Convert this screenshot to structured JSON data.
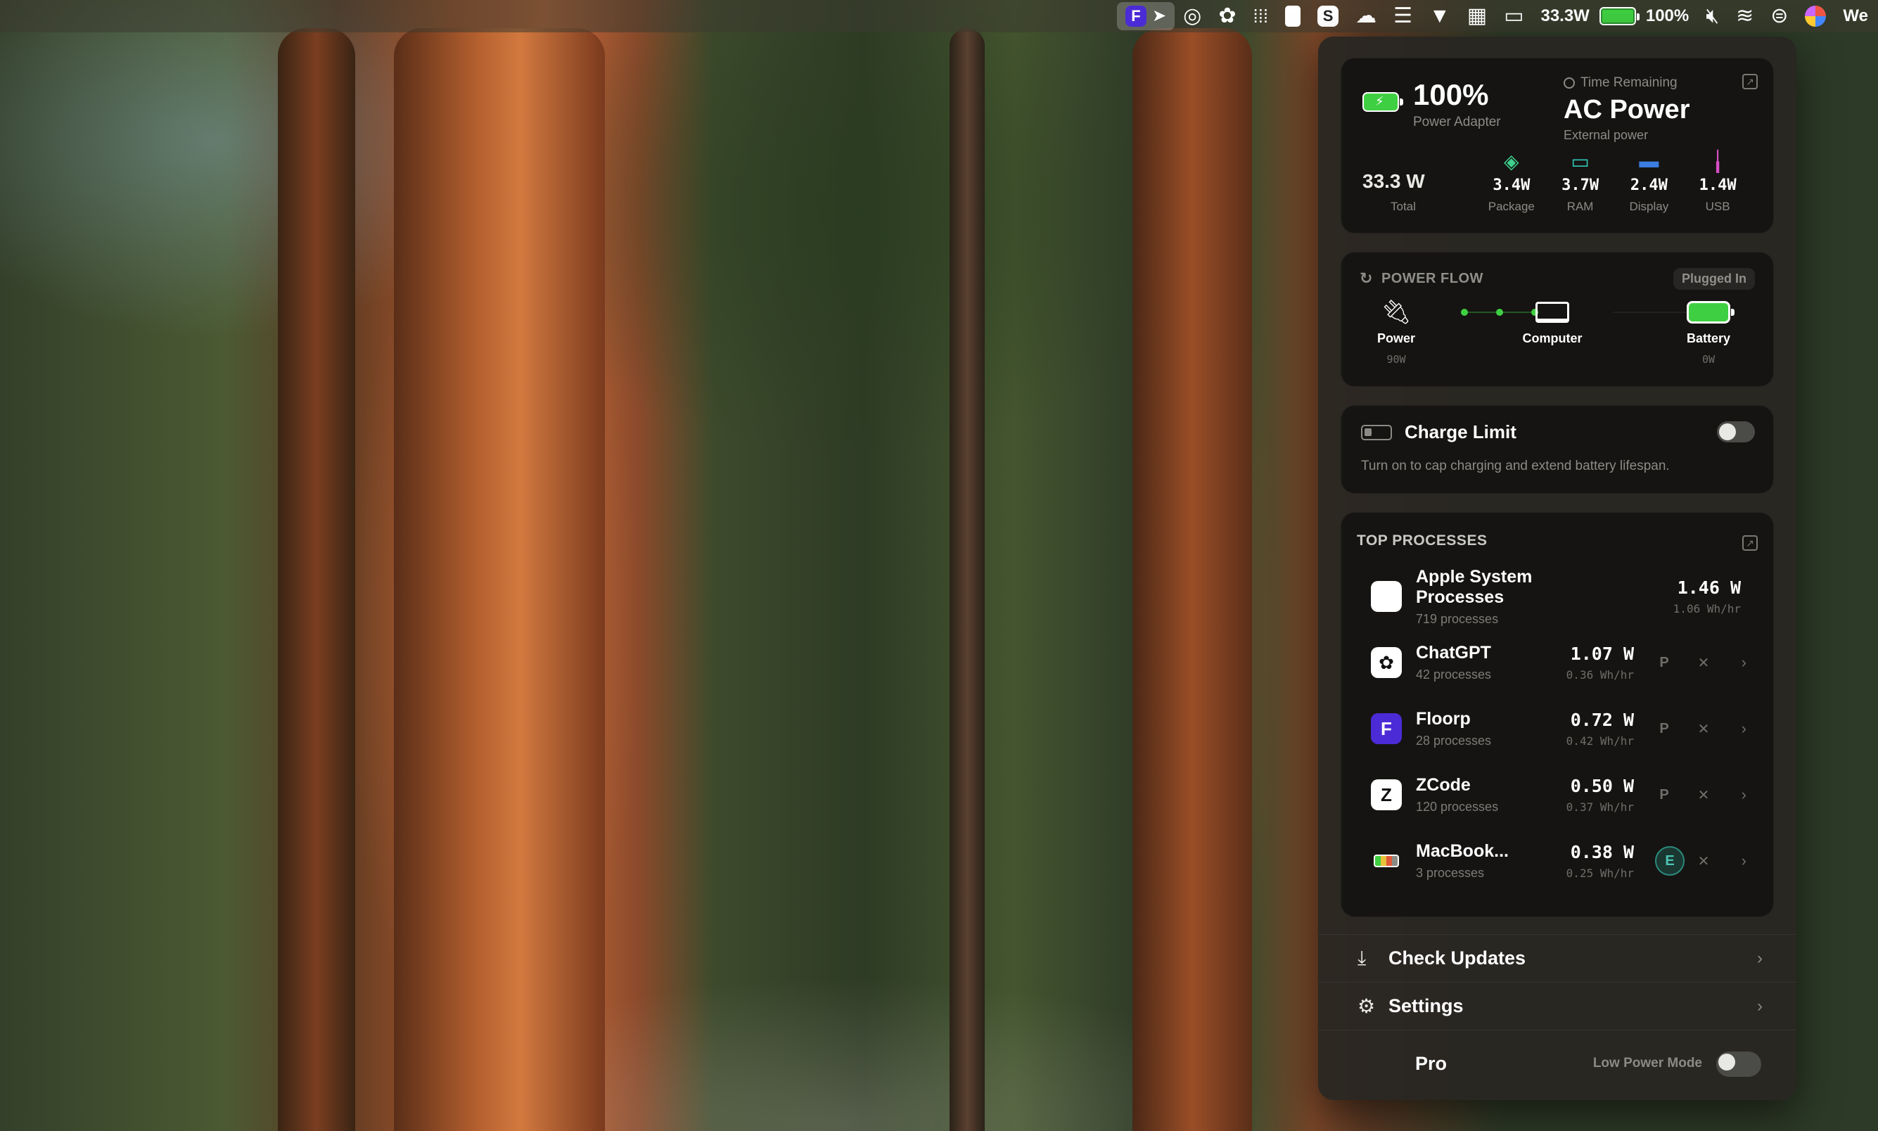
{
  "menubar": {
    "power_readout": "33.3W",
    "battery_percent": "100%",
    "partial_label": "We",
    "icons": [
      "floorp-icon",
      "cursor-icon",
      "target-icon",
      "chatgpt-icon",
      "grid-icon",
      "key-icon",
      "s-app-icon",
      "cloud-icon",
      "stack-icon",
      "wifi-checked-icon",
      "calendar-icon",
      "display-icon",
      "battery-icon",
      "mute-icon",
      "wifi-icon",
      "control-center-icon",
      "avatar-icon"
    ]
  },
  "power_card": {
    "battery_percent": "100%",
    "source": "Power Adapter",
    "time_remaining_label": "Time Remaining",
    "time_remaining_value": "AC Power",
    "time_remaining_sub": "External power",
    "total_value": "33.3 W",
    "total_label": "Total",
    "metrics": [
      {
        "icon": "layers-icon",
        "value": "3.4W",
        "label": "Package",
        "color": "#3fcf8e"
      },
      {
        "icon": "ram-icon",
        "value": "3.7W",
        "label": "RAM",
        "color": "#2fc9b6"
      },
      {
        "icon": "display-icon",
        "value": "2.4W",
        "label": "Display",
        "color": "#3b7de0"
      },
      {
        "icon": "usb-icon",
        "value": "1.4W",
        "label": "USB",
        "color": "#d44fc4"
      }
    ]
  },
  "power_flow": {
    "title": "POWER FLOW",
    "status": "Plugged In",
    "nodes": [
      {
        "label": "Power",
        "value": "90W"
      },
      {
        "label": "Computer",
        "value": ""
      },
      {
        "label": "Battery",
        "value": "0W"
      }
    ]
  },
  "charge_limit": {
    "title": "Charge Limit",
    "description": "Turn on to cap charging and extend battery lifespan.",
    "enabled": false
  },
  "top_processes": {
    "title": "TOP PROCESSES",
    "items": [
      {
        "name": "Apple System Processes",
        "count": "719 processes",
        "watts": "1.46 W",
        "wh": "1.06 Wh/hr",
        "icon": "apple-icon",
        "actions": false
      },
      {
        "name": "ChatGPT",
        "count": "42 processes",
        "watts": "1.07 W",
        "wh": "0.36 Wh/hr",
        "icon": "chatgpt-icon",
        "actions": true,
        "mode": "P"
      },
      {
        "name": "Floorp",
        "count": "28 processes",
        "watts": "0.72 W",
        "wh": "0.42 Wh/hr",
        "icon": "floorp-icon",
        "actions": true,
        "mode": "P"
      },
      {
        "name": "ZCode",
        "count": "120 processes",
        "watts": "0.50 W",
        "wh": "0.37 Wh/hr",
        "icon": "zcode-icon",
        "actions": true,
        "mode": "P"
      },
      {
        "name": "MacBook...",
        "count": "3 processes",
        "watts": "0.38 W",
        "wh": "0.25 Wh/hr",
        "icon": "macbook-battery-icon",
        "actions": true,
        "mode": "E"
      }
    ]
  },
  "menu": {
    "check_updates": "Check Updates",
    "settings": "Settings"
  },
  "footer": {
    "pro_label": "Pro",
    "low_power_label": "Low Power Mode",
    "low_power_enabled": false
  }
}
